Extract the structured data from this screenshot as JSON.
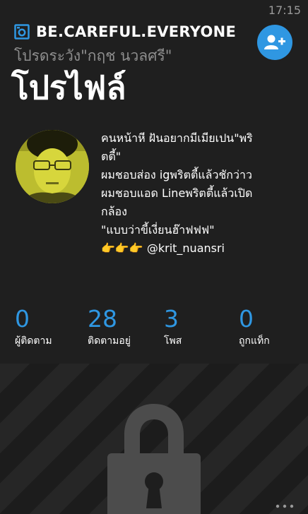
{
  "status_bar": {
    "time": "17:15"
  },
  "header": {
    "app_title": "BE.CAREFUL.EVERYONE",
    "logo_icon": "camera-frame-icon",
    "subtitle": "โปรดระวัง\"กฤช นวลศรี\"",
    "page_title": "โปรไฟล์",
    "follow_button_icon": "add-person-icon"
  },
  "profile": {
    "bio_lines": [
      "คนหน้าหี ฝันอยากมีเมียเปน\"พริ",
      "ตตี้\"",
      "ผมชอบส่อง igพริตตี้แล้วชักว่าว",
      "ผมชอบแอด Lineพริตตี้แล้วเปิด",
      "กล้อง",
      "\"แบบว่าขี้เงี่ยนฮ๊าฟฟฟ\"",
      "👉👉👉 @krit_nuansri"
    ]
  },
  "stats": [
    {
      "value": "0",
      "label": "ผู้ติดตาม"
    },
    {
      "value": "28",
      "label": "ติดตามอยู่"
    },
    {
      "value": "3",
      "label": "โพส"
    },
    {
      "value": "0",
      "label": "ถูกแท็ก"
    }
  ],
  "locked": {
    "icon": "padlock-icon"
  },
  "app_bar": {
    "more_icon": "ellipsis-icon"
  },
  "colors": {
    "background": "#1f1f1f",
    "accent": "#2f97e2",
    "muted_text": "#8e8e8e"
  }
}
